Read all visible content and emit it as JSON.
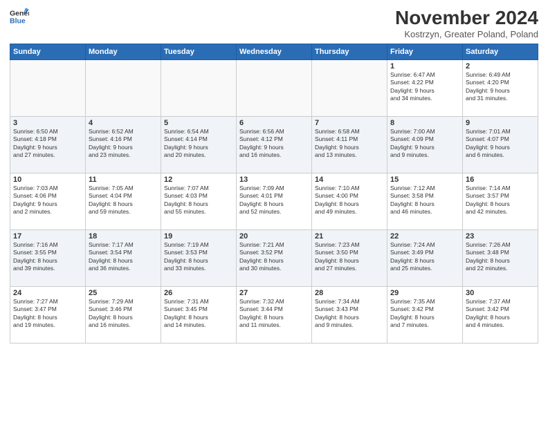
{
  "header": {
    "logo_general": "General",
    "logo_blue": "Blue",
    "month_title": "November 2024",
    "location": "Kostrzyn, Greater Poland, Poland"
  },
  "days_of_week": [
    "Sunday",
    "Monday",
    "Tuesday",
    "Wednesday",
    "Thursday",
    "Friday",
    "Saturday"
  ],
  "weeks": [
    [
      {
        "day": "",
        "info": ""
      },
      {
        "day": "",
        "info": ""
      },
      {
        "day": "",
        "info": ""
      },
      {
        "day": "",
        "info": ""
      },
      {
        "day": "",
        "info": ""
      },
      {
        "day": "1",
        "info": "Sunrise: 6:47 AM\nSunset: 4:22 PM\nDaylight: 9 hours\nand 34 minutes."
      },
      {
        "day": "2",
        "info": "Sunrise: 6:49 AM\nSunset: 4:20 PM\nDaylight: 9 hours\nand 31 minutes."
      }
    ],
    [
      {
        "day": "3",
        "info": "Sunrise: 6:50 AM\nSunset: 4:18 PM\nDaylight: 9 hours\nand 27 minutes."
      },
      {
        "day": "4",
        "info": "Sunrise: 6:52 AM\nSunset: 4:16 PM\nDaylight: 9 hours\nand 23 minutes."
      },
      {
        "day": "5",
        "info": "Sunrise: 6:54 AM\nSunset: 4:14 PM\nDaylight: 9 hours\nand 20 minutes."
      },
      {
        "day": "6",
        "info": "Sunrise: 6:56 AM\nSunset: 4:12 PM\nDaylight: 9 hours\nand 16 minutes."
      },
      {
        "day": "7",
        "info": "Sunrise: 6:58 AM\nSunset: 4:11 PM\nDaylight: 9 hours\nand 13 minutes."
      },
      {
        "day": "8",
        "info": "Sunrise: 7:00 AM\nSunset: 4:09 PM\nDaylight: 9 hours\nand 9 minutes."
      },
      {
        "day": "9",
        "info": "Sunrise: 7:01 AM\nSunset: 4:07 PM\nDaylight: 9 hours\nand 6 minutes."
      }
    ],
    [
      {
        "day": "10",
        "info": "Sunrise: 7:03 AM\nSunset: 4:06 PM\nDaylight: 9 hours\nand 2 minutes."
      },
      {
        "day": "11",
        "info": "Sunrise: 7:05 AM\nSunset: 4:04 PM\nDaylight: 8 hours\nand 59 minutes."
      },
      {
        "day": "12",
        "info": "Sunrise: 7:07 AM\nSunset: 4:03 PM\nDaylight: 8 hours\nand 55 minutes."
      },
      {
        "day": "13",
        "info": "Sunrise: 7:09 AM\nSunset: 4:01 PM\nDaylight: 8 hours\nand 52 minutes."
      },
      {
        "day": "14",
        "info": "Sunrise: 7:10 AM\nSunset: 4:00 PM\nDaylight: 8 hours\nand 49 minutes."
      },
      {
        "day": "15",
        "info": "Sunrise: 7:12 AM\nSunset: 3:58 PM\nDaylight: 8 hours\nand 46 minutes."
      },
      {
        "day": "16",
        "info": "Sunrise: 7:14 AM\nSunset: 3:57 PM\nDaylight: 8 hours\nand 42 minutes."
      }
    ],
    [
      {
        "day": "17",
        "info": "Sunrise: 7:16 AM\nSunset: 3:55 PM\nDaylight: 8 hours\nand 39 minutes."
      },
      {
        "day": "18",
        "info": "Sunrise: 7:17 AM\nSunset: 3:54 PM\nDaylight: 8 hours\nand 36 minutes."
      },
      {
        "day": "19",
        "info": "Sunrise: 7:19 AM\nSunset: 3:53 PM\nDaylight: 8 hours\nand 33 minutes."
      },
      {
        "day": "20",
        "info": "Sunrise: 7:21 AM\nSunset: 3:52 PM\nDaylight: 8 hours\nand 30 minutes."
      },
      {
        "day": "21",
        "info": "Sunrise: 7:23 AM\nSunset: 3:50 PM\nDaylight: 8 hours\nand 27 minutes."
      },
      {
        "day": "22",
        "info": "Sunrise: 7:24 AM\nSunset: 3:49 PM\nDaylight: 8 hours\nand 25 minutes."
      },
      {
        "day": "23",
        "info": "Sunrise: 7:26 AM\nSunset: 3:48 PM\nDaylight: 8 hours\nand 22 minutes."
      }
    ],
    [
      {
        "day": "24",
        "info": "Sunrise: 7:27 AM\nSunset: 3:47 PM\nDaylight: 8 hours\nand 19 minutes."
      },
      {
        "day": "25",
        "info": "Sunrise: 7:29 AM\nSunset: 3:46 PM\nDaylight: 8 hours\nand 16 minutes."
      },
      {
        "day": "26",
        "info": "Sunrise: 7:31 AM\nSunset: 3:45 PM\nDaylight: 8 hours\nand 14 minutes."
      },
      {
        "day": "27",
        "info": "Sunrise: 7:32 AM\nSunset: 3:44 PM\nDaylight: 8 hours\nand 11 minutes."
      },
      {
        "day": "28",
        "info": "Sunrise: 7:34 AM\nSunset: 3:43 PM\nDaylight: 8 hours\nand 9 minutes."
      },
      {
        "day": "29",
        "info": "Sunrise: 7:35 AM\nSunset: 3:42 PM\nDaylight: 8 hours\nand 7 minutes."
      },
      {
        "day": "30",
        "info": "Sunrise: 7:37 AM\nSunset: 3:42 PM\nDaylight: 8 hours\nand 4 minutes."
      }
    ]
  ]
}
